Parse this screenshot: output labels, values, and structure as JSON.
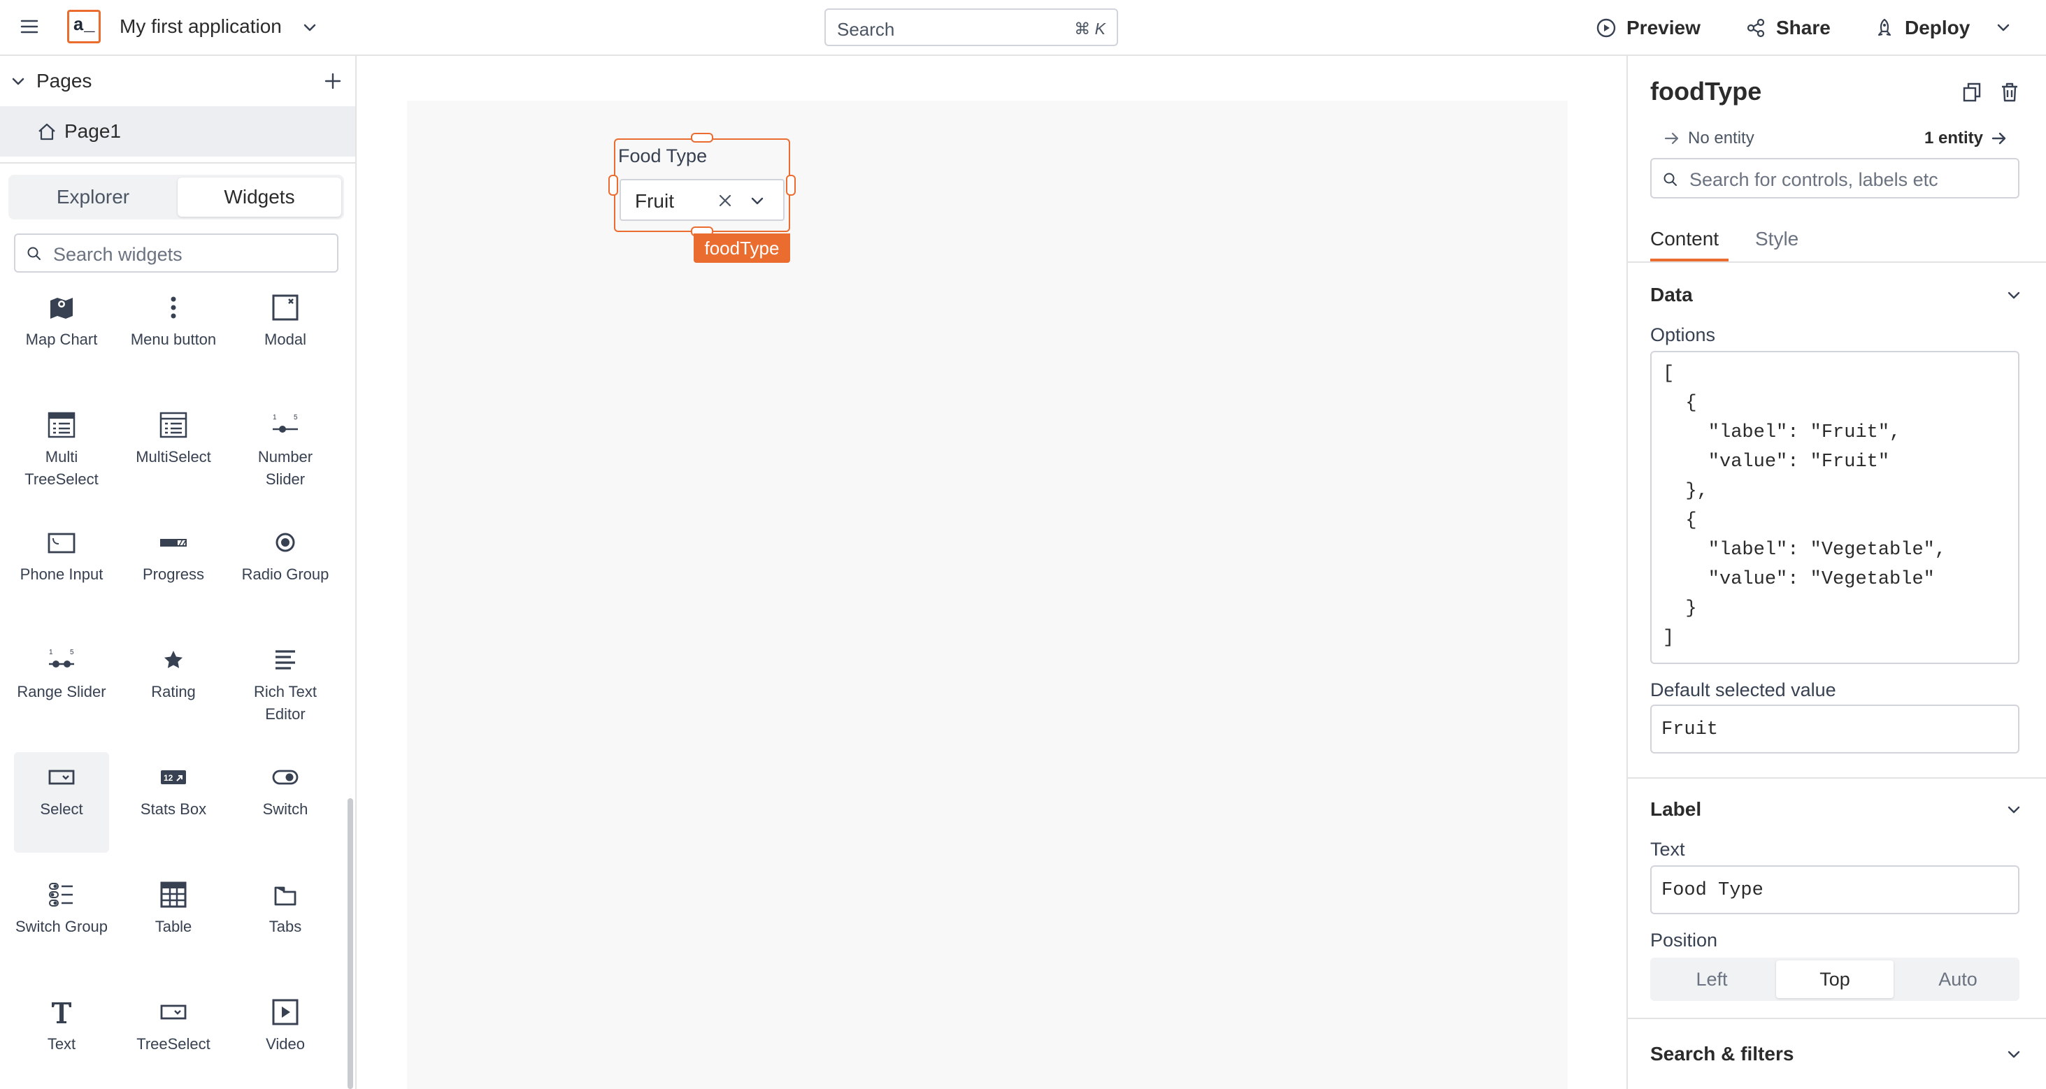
{
  "topbar": {
    "logo_text": "a_",
    "app_name": "My first application",
    "search_placeholder": "Search",
    "search_shortcut": "⌘ K",
    "preview_label": "Preview",
    "share_label": "Share",
    "deploy_label": "Deploy"
  },
  "sidebar": {
    "pages_title": "Pages",
    "pages": [
      {
        "label": "Page1"
      }
    ],
    "tabs": [
      {
        "label": "Explorer",
        "active": false
      },
      {
        "label": "Widgets",
        "active": true
      }
    ],
    "widget_search_placeholder": "Search widgets",
    "widgets": [
      {
        "label": "Map Chart",
        "icon": "map-chart-icon"
      },
      {
        "label": "Menu button",
        "icon": "menu-button-icon"
      },
      {
        "label": "Modal",
        "icon": "modal-icon"
      },
      {
        "label": "Multi TreeSelect",
        "icon": "multi-treeselect-icon"
      },
      {
        "label": "MultiSelect",
        "icon": "multiselect-icon"
      },
      {
        "label": "Number Slider",
        "icon": "number-slider-icon"
      },
      {
        "label": "Phone Input",
        "icon": "phone-input-icon"
      },
      {
        "label": "Progress",
        "icon": "progress-icon"
      },
      {
        "label": "Radio Group",
        "icon": "radio-group-icon"
      },
      {
        "label": "Range Slider",
        "icon": "range-slider-icon"
      },
      {
        "label": "Rating",
        "icon": "rating-icon"
      },
      {
        "label": "Rich Text Editor",
        "icon": "rich-text-editor-icon"
      },
      {
        "label": "Select",
        "icon": "select-icon",
        "selected": true
      },
      {
        "label": "Stats Box",
        "icon": "stats-box-icon"
      },
      {
        "label": "Switch",
        "icon": "switch-icon"
      },
      {
        "label": "Switch Group",
        "icon": "switch-group-icon"
      },
      {
        "label": "Table",
        "icon": "table-icon"
      },
      {
        "label": "Tabs",
        "icon": "tabs-icon"
      },
      {
        "label": "Text",
        "icon": "text-icon"
      },
      {
        "label": "TreeSelect",
        "icon": "treeselect-icon"
      },
      {
        "label": "Video",
        "icon": "video-icon"
      }
    ]
  },
  "canvas": {
    "widget_label": "Food Type",
    "widget_value": "Fruit",
    "widget_name": "foodType"
  },
  "panel": {
    "title": "foodType",
    "no_entity": "No entity",
    "entity_count": "1 entity",
    "search_placeholder": "Search for controls, labels etc",
    "tabs": [
      {
        "label": "Content",
        "active": true
      },
      {
        "label": "Style",
        "active": false
      }
    ],
    "data_section": {
      "title": "Data",
      "options_label": "Options",
      "options_code": [
        "[",
        "  {",
        "    \"label\": \"Fruit\",",
        "    \"value\": \"Fruit\"",
        "  },",
        "  {",
        "    \"label\": \"Vegetable\",",
        "    \"value\": \"Vegetable\"",
        "  }",
        "]"
      ],
      "default_label": "Default selected value",
      "default_value": "Fruit"
    },
    "label_section": {
      "title": "Label",
      "text_label": "Text",
      "text_value": "Food Type",
      "position_label": "Position",
      "position_options": [
        "Left",
        "Top",
        "Auto"
      ],
      "position_selected": "Top"
    },
    "search_section": {
      "title": "Search & filters"
    }
  },
  "colors": {
    "accent": "#ea6c2e",
    "border": "#d1d5db",
    "canvas_bg": "#f8f8f8"
  }
}
